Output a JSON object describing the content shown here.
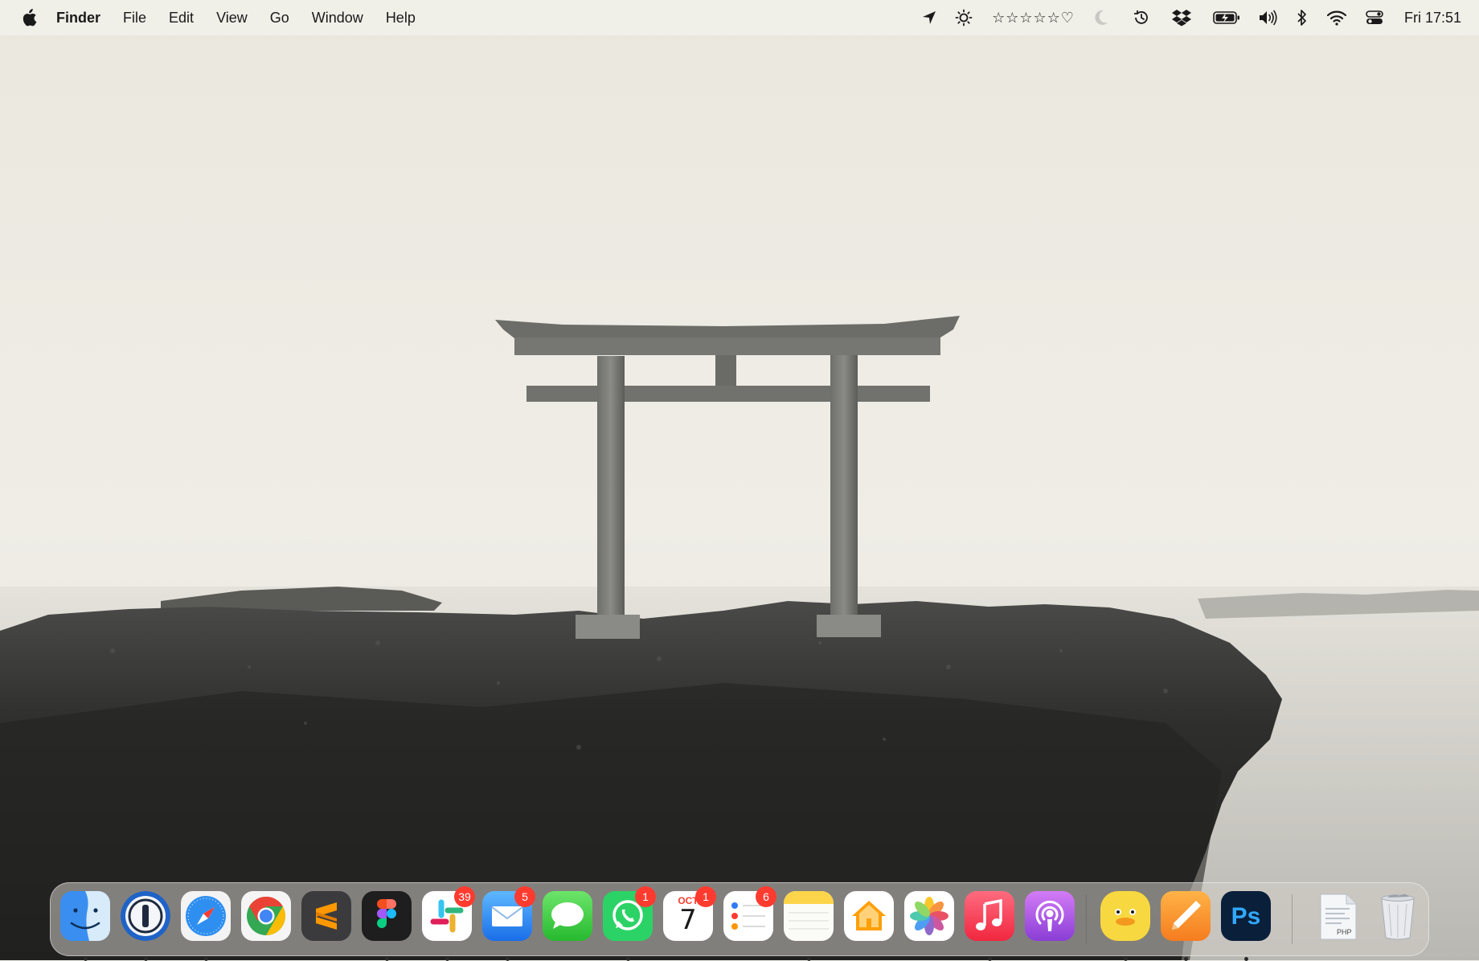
{
  "menubar": {
    "apple_icon": "apple-logo-icon",
    "app_name": "Finder",
    "menus": [
      "File",
      "Edit",
      "View",
      "Go",
      "Window",
      "Help"
    ],
    "status_icons": [
      "location-arrow-icon",
      "brightness-sun-icon"
    ],
    "rating": "☆☆☆☆☆♡",
    "tray_icons": [
      "night-moon-icon",
      "time-machine-icon",
      "dropbox-icon",
      "battery-charging-icon",
      "volume-icon",
      "bluetooth-icon",
      "wifi-icon",
      "control-center-icon"
    ],
    "clock": "Fri 17:51"
  },
  "dock": {
    "apps": [
      {
        "name": "Finder",
        "icon": "finder-icon",
        "badge": "",
        "running": true
      },
      {
        "name": "1Password",
        "icon": "1password-icon",
        "badge": "",
        "running": true
      },
      {
        "name": "Safari",
        "icon": "safari-icon",
        "badge": "",
        "running": true
      },
      {
        "name": "Chrome",
        "icon": "chrome-icon",
        "badge": "",
        "running": false
      },
      {
        "name": "Sublime Text",
        "icon": "sublime-text-icon",
        "badge": "",
        "running": false
      },
      {
        "name": "Figma",
        "icon": "figma-icon",
        "badge": "",
        "running": true
      },
      {
        "name": "Slack",
        "icon": "slack-icon",
        "badge": "39",
        "running": true
      },
      {
        "name": "Mail",
        "icon": "mail-icon",
        "badge": "5",
        "running": true
      },
      {
        "name": "Messages",
        "icon": "messages-icon",
        "badge": "",
        "running": false
      },
      {
        "name": "WhatsApp",
        "icon": "whatsapp-icon",
        "badge": "1",
        "running": true
      },
      {
        "name": "Calendar",
        "icon": "calendar-icon",
        "badge": "1",
        "running": false,
        "month": "OCT",
        "day": "7"
      },
      {
        "name": "Reminders",
        "icon": "reminders-icon",
        "badge": "6",
        "running": false
      },
      {
        "name": "Notes",
        "icon": "notes-icon",
        "badge": "",
        "running": true
      },
      {
        "name": "Home",
        "icon": "home-icon",
        "badge": "",
        "running": false
      },
      {
        "name": "Photos",
        "icon": "photos-icon",
        "badge": "",
        "running": false
      },
      {
        "name": "Music",
        "icon": "music-icon",
        "badge": "",
        "running": true
      },
      {
        "name": "Podcasts",
        "icon": "podcasts-icon",
        "badge": "",
        "running": false
      },
      {
        "name": "Cyberduck",
        "icon": "cyberduck-icon",
        "badge": "",
        "running": true
      },
      {
        "name": "Pages",
        "icon": "pencil-app-icon",
        "badge": "",
        "running": true
      },
      {
        "name": "Photoshop",
        "icon": "photoshop-icon",
        "badge": "",
        "running": true,
        "label": "Ps"
      },
      {
        "name": "PHP File",
        "icon": "php-document-icon",
        "badge": "",
        "running": false,
        "label": "PHP"
      },
      {
        "name": "Trash",
        "icon": "trash-icon",
        "badge": "",
        "running": false
      }
    ]
  }
}
